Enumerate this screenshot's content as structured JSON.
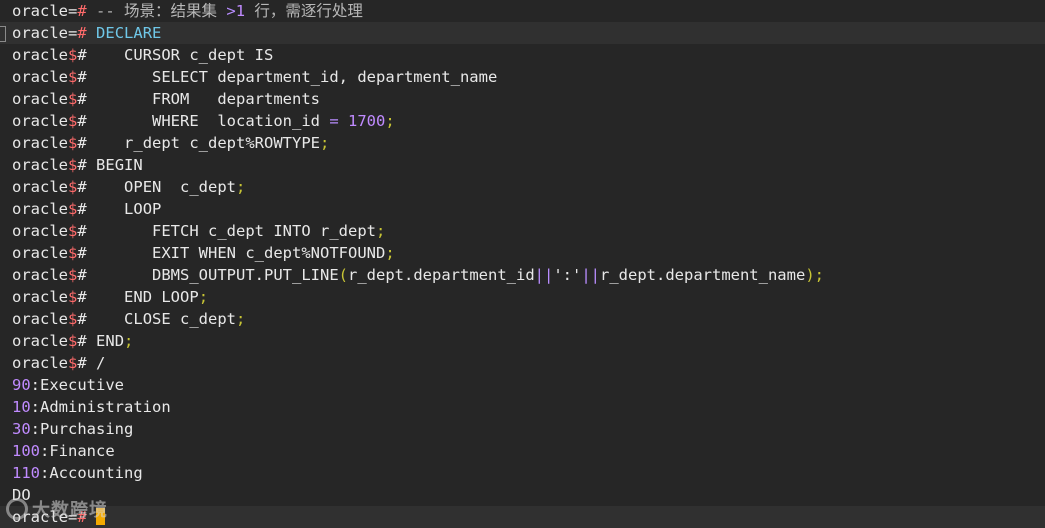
{
  "prompt": {
    "name": "oracle",
    "primary_eq": "=",
    "continuation_sym": "$",
    "hash": "#"
  },
  "lines": {
    "l0": {
      "comment": "-- 场景：结果集 ",
      "op": ">",
      "num": "1",
      "tail": " 行，需逐行处理"
    },
    "l1": {
      "code": "DECLARE"
    },
    "l2": {
      "code": "   CURSOR c_dept IS"
    },
    "l3": {
      "code": "      SELECT department_id, department_name"
    },
    "l4": {
      "code": "      FROM   departments"
    },
    "l5": {
      "pre": "      WHERE  location_id ",
      "eq": "=",
      "sp": " ",
      "num": "1700",
      "semi": ";"
    },
    "l6": {
      "code": "   r_dept c_dept%ROWTYPE",
      "semi": ";"
    },
    "l7": {
      "code": "BEGIN"
    },
    "l8": {
      "code": "   OPEN  c_dept",
      "semi": ";"
    },
    "l9": {
      "code": "   LOOP"
    },
    "l10": {
      "code": "      FETCH c_dept INTO r_dept",
      "semi": ";"
    },
    "l11": {
      "code": "      EXIT WHEN c_dept%NOTFOUND",
      "semi": ";"
    },
    "l12": {
      "pre": "      DBMS_OUTPUT.PUT_LINE",
      "lp": "(",
      "a": "r_dept.department_id",
      "pipe1": "||",
      "str": "':'",
      "pipe2": "||",
      "b": "r_dept.department_name",
      "rp": ")",
      "semi": ";"
    },
    "l13": {
      "code": "   END LOOP",
      "semi": ";"
    },
    "l14": {
      "code": "   CLOSE c_dept",
      "semi": ";"
    },
    "l15": {
      "code": "END",
      "semi": ";"
    },
    "l16": {
      "code": "/"
    }
  },
  "output": [
    {
      "num": "90",
      "colon": ":",
      "name": "Executive"
    },
    {
      "num": "10",
      "colon": ":",
      "name": "Administration"
    },
    {
      "num": "30",
      "colon": ":",
      "name": "Purchasing"
    },
    {
      "num": "100",
      "colon": ":",
      "name": "Finance"
    },
    {
      "num": "110",
      "colon": ":",
      "name": "Accounting"
    }
  ],
  "do_line": "DO",
  "watermark": {
    "brand": "大数跨境",
    "icon": "circle-logo-icon"
  },
  "colors": {
    "background": "#262626",
    "prompt_hash": "#ff6b6b",
    "keyword_cyan": "#6fc7e8",
    "number": "#c08bff",
    "semicolon": "#c7c435",
    "cursor": "#f3a900"
  }
}
